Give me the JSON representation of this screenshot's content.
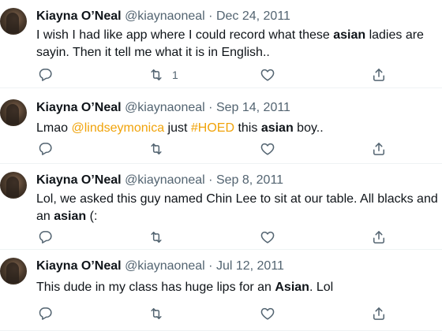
{
  "tweets": [
    {
      "name": "Kiayna O’Neal",
      "handle": "@kiaynaoneal",
      "sep": "·",
      "date": "Dec 24, 2011",
      "segments": [
        {
          "t": "I wish I had like app where I could record what these "
        },
        {
          "t": "asian",
          "style": "bold"
        },
        {
          "t": " ladies are sayin. Then it tell me what it is in English.."
        }
      ],
      "retweets": "1"
    },
    {
      "name": "Kiayna O’Neal",
      "handle": "@kiaynaoneal",
      "sep": "·",
      "date": "Sep 14, 2011",
      "segments": [
        {
          "t": "Lmao "
        },
        {
          "t": "@lindseymonica",
          "style": "link"
        },
        {
          "t": " just "
        },
        {
          "t": "#HOED",
          "style": "link"
        },
        {
          "t": " this "
        },
        {
          "t": "asian",
          "style": "bold"
        },
        {
          "t": " boy.."
        }
      ],
      "retweets": ""
    },
    {
      "name": "Kiayna O’Neal",
      "handle": "@kiaynaoneal",
      "sep": "·",
      "date": "Sep 8, 2011",
      "segments": [
        {
          "t": "Lol, we asked this guy named Chin Lee to sit at our table. All blacks and an "
        },
        {
          "t": "asian",
          "style": "bold"
        },
        {
          "t": " (:"
        }
      ],
      "retweets": ""
    },
    {
      "name": "Kiayna O’Neal",
      "handle": "@kiaynaoneal",
      "sep": "·",
      "date": "Jul 12, 2011",
      "segments": [
        {
          "t": "This dude in my class has huge lips for an "
        },
        {
          "t": "Asian",
          "style": "bold"
        },
        {
          "t": ". Lol"
        }
      ],
      "retweets": ""
    }
  ],
  "icons": {
    "reply": "reply-icon",
    "retweet": "retweet-icon",
    "like": "like-icon",
    "share": "share-icon"
  },
  "colors": {
    "link": "#f0a30a",
    "meta": "#536471",
    "text": "#0f1419"
  }
}
